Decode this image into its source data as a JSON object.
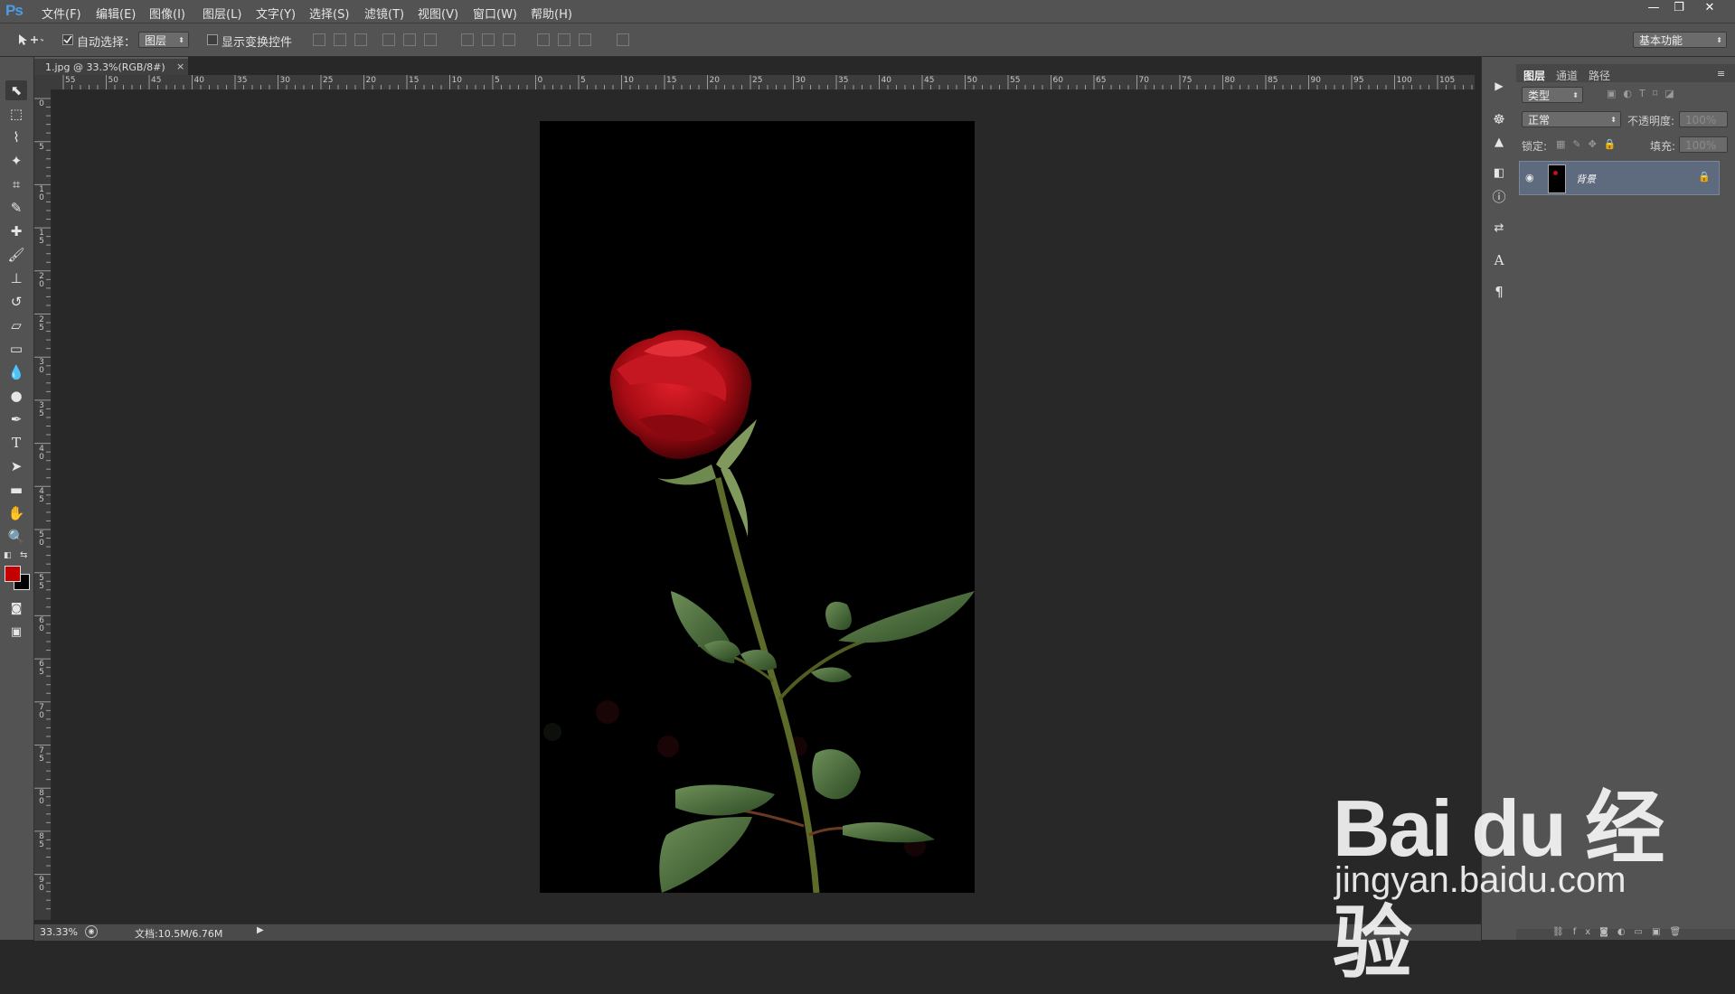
{
  "app": {
    "logo": "Ps"
  },
  "menu": [
    "文件(F)",
    "编辑(E)",
    "图像(I)",
    "图层(L)",
    "文字(Y)",
    "选择(S)",
    "滤镜(T)",
    "视图(V)",
    "窗口(W)",
    "帮助(H)"
  ],
  "window_controls": {
    "minimize": "—",
    "restore": "❐",
    "close": "✕"
  },
  "options": {
    "auto_select_label": "自动选择：",
    "auto_select_checked": true,
    "auto_select_target": "图层",
    "show_transform_label": "显示变换控件",
    "show_transform_checked": false,
    "workspace": "基本功能"
  },
  "document": {
    "tab_title": "1.jpg @ 33.3%(RGB/8#)",
    "tab_close": "×"
  },
  "ruler": {
    "h_labels": [
      "55",
      "50",
      "45",
      "40",
      "35",
      "30",
      "25",
      "20",
      "15",
      "10",
      "5",
      "0",
      "5",
      "10",
      "15",
      "20",
      "25",
      "30",
      "35",
      "40",
      "45",
      "50",
      "55",
      "60",
      "65",
      "70",
      "75",
      "80",
      "85",
      "90",
      "95",
      "100",
      "105"
    ],
    "v_labels": [
      "0",
      "5",
      "10",
      "15",
      "20",
      "25",
      "30",
      "35",
      "40",
      "45",
      "50",
      "55",
      "60",
      "65",
      "70",
      "75",
      "80",
      "85",
      "90"
    ]
  },
  "status": {
    "zoom": "33.33%",
    "doc_size": "文档:10.5M/6.76M"
  },
  "colors": {
    "foreground": "#c40000",
    "background": "#000000",
    "accent_logo": "#4d9be5"
  },
  "layers_panel": {
    "tabs": [
      "图层",
      "通道",
      "路径"
    ],
    "active_tab": "图层",
    "filter_kind": "类型",
    "blend_mode": "正常",
    "opacity_label": "不透明度:",
    "opacity_value": "100%",
    "lock_label": "锁定:",
    "fill_label": "填充:",
    "fill_value": "100%",
    "layers": [
      {
        "name": "背景",
        "visible": true,
        "locked": true
      }
    ]
  },
  "watermark": {
    "logo": "Bai du 经验",
    "url": "jingyan.baidu.com"
  }
}
